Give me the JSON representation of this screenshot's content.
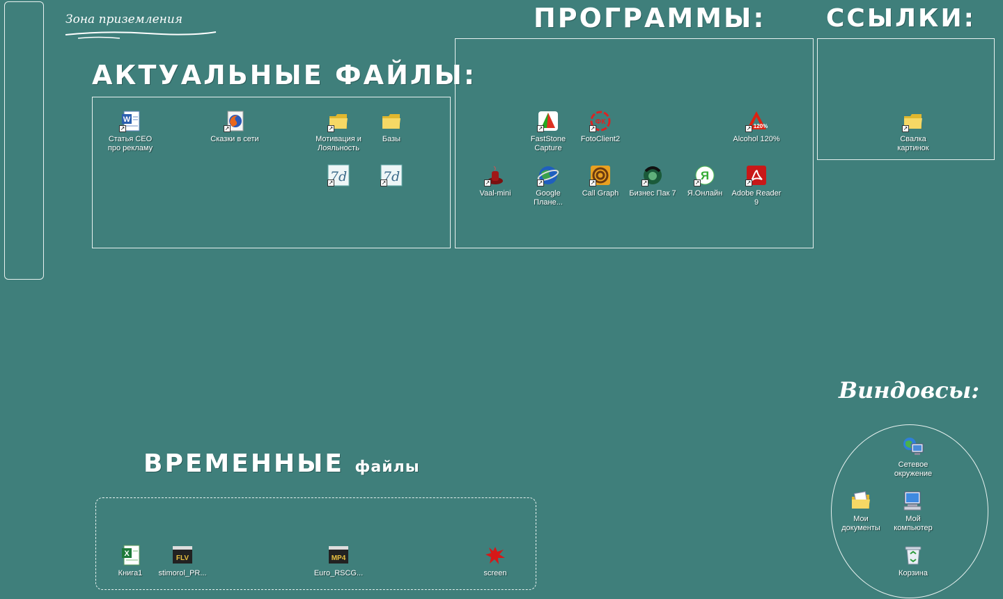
{
  "landing_zone": {
    "label": "Зона приземления"
  },
  "sections": {
    "current_files": {
      "title": "АКТУАЛЬНЫЕ ФАЙЛЫ:"
    },
    "programs": {
      "title": "ПРОГРАММЫ:"
    },
    "links": {
      "title": "ССЫЛКИ:"
    },
    "windows": {
      "title": "Виндовсы:"
    },
    "temp_files": {
      "title_big": "ВРЕМЕННЫЕ",
      "title_small": "файлы"
    }
  },
  "icons": {
    "current_files": [
      {
        "label": "Статья CEO про рекламу",
        "icon": "word-doc-icon",
        "shortcut": true
      },
      {
        "label": "Сказки в сети",
        "icon": "firefox-icon",
        "shortcut": true
      },
      {
        "label": "Мотивация и Лояльность",
        "icon": "folder-icon",
        "shortcut": true
      },
      {
        "label": "Базы",
        "icon": "folder-icon",
        "shortcut": false
      },
      {
        "label": "",
        "icon": "7d-app-icon",
        "shortcut": true
      },
      {
        "label": "",
        "icon": "7d-app-icon",
        "shortcut": true
      }
    ],
    "programs": [
      {
        "label": "FastStone Capture",
        "icon": "faststone-icon",
        "shortcut": true
      },
      {
        "label": "FotoClient2",
        "icon": "fotoclient-icon",
        "shortcut": true
      },
      {
        "label": "Alcohol 120%",
        "icon": "alcohol-icon",
        "shortcut": true
      },
      {
        "label": "Vaal-mini",
        "icon": "vaal-icon",
        "shortcut": true
      },
      {
        "label": "Google Плане...",
        "icon": "google-earth-icon",
        "shortcut": true
      },
      {
        "label": "Call Graph",
        "icon": "callgraph-icon",
        "shortcut": true
      },
      {
        "label": "Бизнес Пак 7",
        "icon": "bizpak-icon",
        "shortcut": true
      },
      {
        "label": "Я.Онлайн",
        "icon": "yandex-online-icon",
        "shortcut": true
      },
      {
        "label": "Adobe Reader 9",
        "icon": "adobe-reader-icon",
        "shortcut": true
      }
    ],
    "links": [
      {
        "label": "Свалка картинок",
        "icon": "folder-icon",
        "shortcut": true
      }
    ],
    "windows": [
      {
        "label": "Сетевое окружение",
        "icon": "network-icon",
        "shortcut": false
      },
      {
        "label": "Мои документы",
        "icon": "my-documents-icon",
        "shortcut": false
      },
      {
        "label": "Мой компьютер",
        "icon": "my-computer-icon",
        "shortcut": false
      },
      {
        "label": "Корзина",
        "icon": "recycle-bin-icon",
        "shortcut": false
      }
    ],
    "temp_files": [
      {
        "label": "Книга1",
        "icon": "excel-icon",
        "shortcut": false
      },
      {
        "label": "stimorol_PR...",
        "icon": "flv-icon",
        "shortcut": false
      },
      {
        "label": "Euro_RSCG...",
        "icon": "mp4-icon",
        "shortcut": false
      },
      {
        "label": "screen",
        "icon": "splat-icon",
        "shortcut": false
      }
    ]
  },
  "colors": {
    "desktop": "#3f7f7b",
    "lines": "#e8f2f0"
  }
}
